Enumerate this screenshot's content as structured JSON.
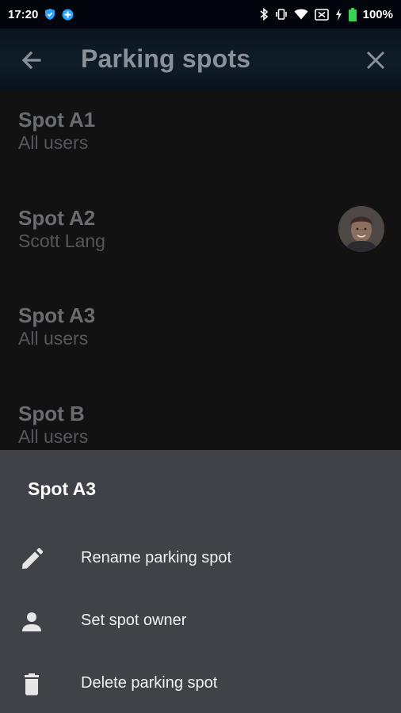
{
  "status_bar": {
    "time": "17:20",
    "battery": "100%",
    "icons": [
      "shield-icon",
      "vpn-icon",
      "bluetooth-icon",
      "vibrate-icon",
      "wifi-icon",
      "no-sim-icon",
      "charging-icon",
      "battery-icon"
    ],
    "battery_color": "#39d353"
  },
  "app_bar": {
    "title": "Parking spots",
    "back_icon": "arrow-left-icon",
    "close_icon": "close-icon"
  },
  "spots": [
    {
      "name": "Spot A1",
      "owner": "All users"
    },
    {
      "name": "Spot A2",
      "owner": "Scott Lang"
    },
    {
      "name": "Spot A3",
      "owner": "All users"
    },
    {
      "name": "Spot B",
      "owner": "All users"
    }
  ],
  "sheet": {
    "title": "Spot A3",
    "actions": [
      {
        "label": "Rename parking spot",
        "icon": "pencil-icon"
      },
      {
        "label": "Set spot owner",
        "icon": "person-icon"
      },
      {
        "label": "Delete parking spot",
        "icon": "trash-icon"
      }
    ]
  },
  "colors": {
    "sheet_background": "#414148",
    "list_background": "#121212",
    "scrim_text": "#6a6c70"
  }
}
